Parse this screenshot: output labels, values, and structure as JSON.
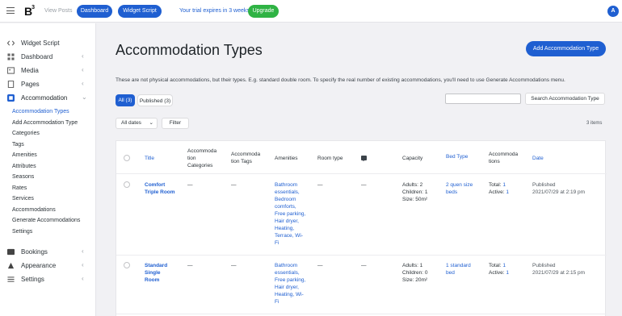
{
  "topbar": {
    "logo": "B",
    "view_posts": "View Posts",
    "dashboard_btn": "Dashboard",
    "widget_btn": "Widget Script",
    "trial_text": "Your trial expires in 3 weeks",
    "upgrade_btn": "Upgrade",
    "avatar_letter": "A"
  },
  "sidebar": {
    "items": [
      {
        "label": "Widget Script",
        "icon": "code-icon"
      },
      {
        "label": "Dashboard",
        "icon": "dashboard-icon"
      },
      {
        "label": "Media",
        "icon": "media-icon"
      },
      {
        "label": "Pages",
        "icon": "pages-icon"
      },
      {
        "label": "Accommodation",
        "icon": "accommodation-icon"
      }
    ],
    "submenu": [
      "Accommodation Types",
      "Add Accommodation Type",
      "Categories",
      "Tags",
      "Amenities",
      "Attributes",
      "Seasons",
      "Rates",
      "Services",
      "Accommodations",
      "Generate Accommodations",
      "Settings"
    ],
    "bottom_items": [
      {
        "label": "Bookings",
        "icon": "bookings-icon"
      },
      {
        "label": "Appearance",
        "icon": "appearance-icon"
      },
      {
        "label": "Settings",
        "icon": "settings-icon"
      }
    ]
  },
  "main": {
    "title": "Accommodation Types",
    "add_button": "Add Accommodation Type",
    "notice": "These are not physical accommodations, but their types. E.g. standard double room. To specify the real number of existing accommodations, you'll need to use Generate Accommodations menu.",
    "tabs": [
      {
        "label": "All (3)"
      },
      {
        "label": "Published (3)"
      }
    ],
    "search_button": "Search Accommodation Type",
    "search_value": "",
    "date_filter": "All dates",
    "filter_button": "Filter",
    "items_count": "3 items"
  },
  "table": {
    "headers": {
      "title": "Title",
      "categories": "Accommoda\ntion\nCategories",
      "tags": "Accommoda\ntion Tags",
      "amenities": "Amenities",
      "room_type": "Room type",
      "capacity": "Capacity",
      "bed_type": "Bed Type",
      "accommodations": "Accommoda\ntions",
      "date": "Date"
    },
    "rows": [
      {
        "title": "Comfort\nTriple Room",
        "categories": "—",
        "tags": "—",
        "amenities": "Bathroom\nessentials,\nBedroom\ncomforts,\nFree parking,\nHair dryer,\nHeating,\nTerrace, Wi-\nFi",
        "room_type": "—",
        "comments": "—",
        "capacity": "Adults: 2\nChildren: 1\nSize: 50m²",
        "bed_type": "2 quen size\nbeds",
        "acc_total_label": "Total:",
        "acc_total": "1",
        "acc_active_label": "Active:",
        "acc_active": "1",
        "date_status": "Published",
        "date_value": "2021/07/29 at 2:19 pm"
      },
      {
        "title": "Standard\nSingle\nRoom",
        "categories": "—",
        "tags": "—",
        "amenities": "Bathroom\nessentials,\nFree parking,\nHair dryer,\nHeating, Wi-\nFi",
        "room_type": "—",
        "comments": "—",
        "capacity": "Adults: 1\nChildren: 0\nSize: 20m²",
        "bed_type": "1 standard\nbed",
        "acc_total_label": "Total:",
        "acc_total": "1",
        "acc_active_label": "Active:",
        "acc_active": "1",
        "date_status": "Published",
        "date_value": "2021/07/29 at 2:15 pm"
      }
    ]
  }
}
